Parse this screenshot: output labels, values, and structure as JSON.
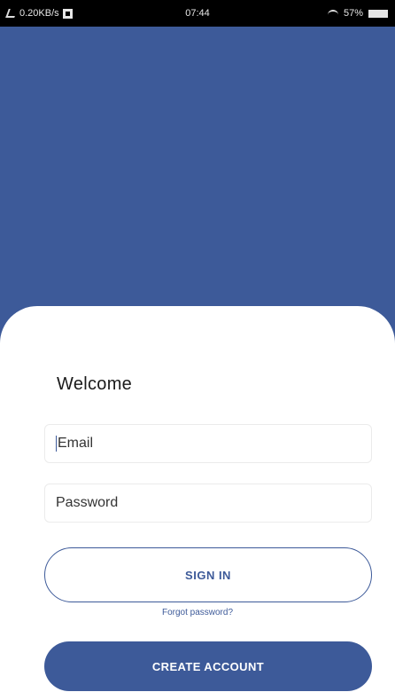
{
  "status_bar": {
    "left_text": "0.20KB/s",
    "time": "07:44",
    "battery": "57%"
  },
  "colors": {
    "primary": "#3d5a99",
    "card_background": "#ffffff",
    "status_bar_background": "#000000"
  },
  "login": {
    "welcome_title": "Welcome",
    "email_placeholder": "Email",
    "password_placeholder": "Password",
    "sign_in_label": "SIGN IN",
    "forgot_password_label": "Forgot password?",
    "create_account_label": "CREATE ACCOUNT"
  }
}
